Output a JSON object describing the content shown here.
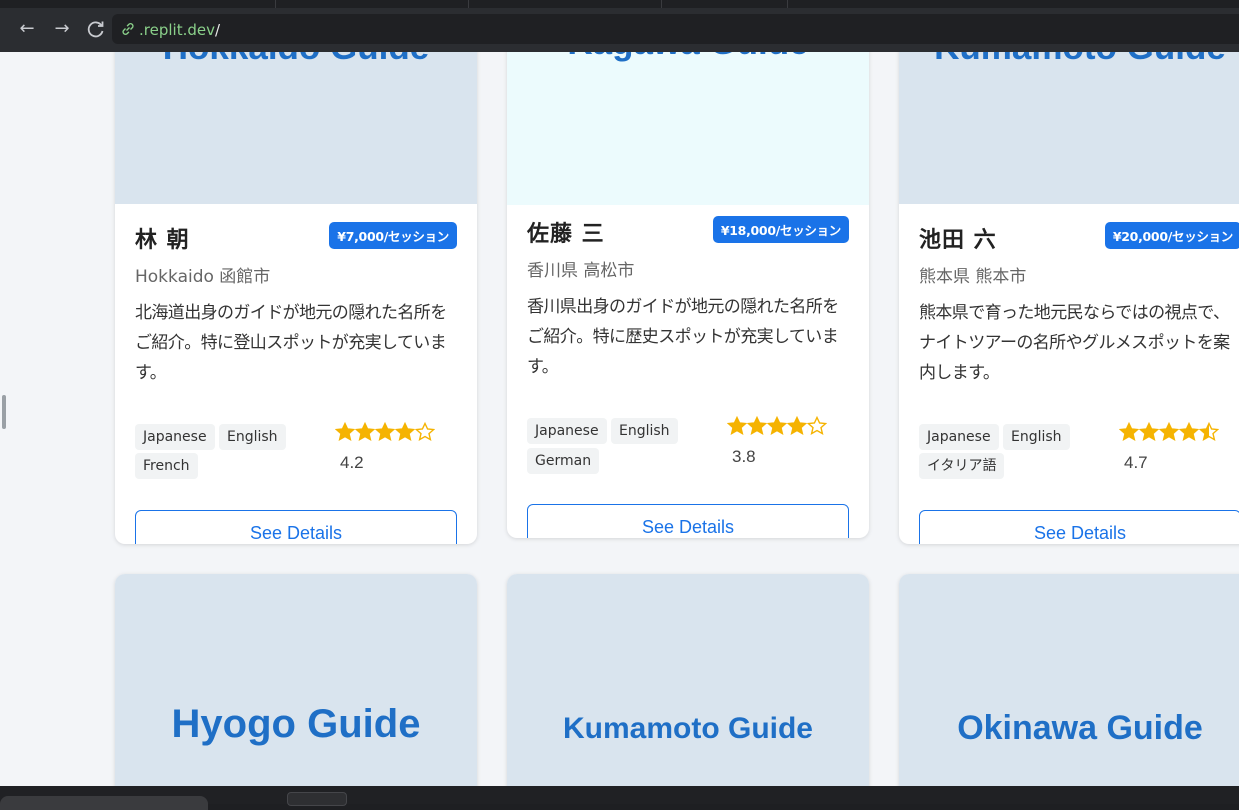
{
  "browser": {
    "url_host": ".replit.dev",
    "url_path": "/",
    "back_glyph": "←",
    "forward_glyph": "→",
    "reload_glyph": "C"
  },
  "cards": [
    {
      "banner_title": "Hokkaido Guide",
      "name": "林 朝",
      "price": "¥7,000/セッション",
      "location": "Hokkaido 函館市",
      "description": "北海道出身のガイドが地元の隠れた名所をご紹介。特に登山スポットが充実しています。",
      "languages": [
        "Japanese",
        "English",
        "French"
      ],
      "rating": 4.2,
      "rating_label": "4.2",
      "button_label": "See Details"
    },
    {
      "banner_title": "Kagawa Guide",
      "name": "佐藤 三",
      "price": "¥18,000/セッション",
      "location": "香川県 高松市",
      "description": "香川県出身のガイドが地元の隠れた名所をご紹介。特に歴史スポットが充実しています。",
      "languages": [
        "Japanese",
        "English",
        "German"
      ],
      "rating": 3.8,
      "rating_label": "3.8",
      "button_label": "See Details"
    },
    {
      "banner_title": "Kumamoto Guide",
      "name": "池田 六",
      "price": "¥20,000/セッション",
      "location": "熊本県 熊本市",
      "description": "熊本県で育った地元民ならではの視点で、ナイトツアーの名所やグルメスポットを案内します。",
      "languages": [
        "Japanese",
        "English",
        "イタリア語"
      ],
      "rating": 4.7,
      "rating_label": "4.7",
      "button_label": "See Details"
    }
  ],
  "next_row": [
    {
      "banner_title": "Hyogo Guide"
    },
    {
      "banner_title": "Kumamoto Guide"
    },
    {
      "banner_title": "Okinawa Guide"
    }
  ],
  "colors": {
    "accent": "#1a73e8",
    "banner_blue": "#d9e4ee",
    "banner_cyan": "#ecfbfd",
    "banner_text": "#1f6fc6",
    "star": "#f5b301"
  }
}
